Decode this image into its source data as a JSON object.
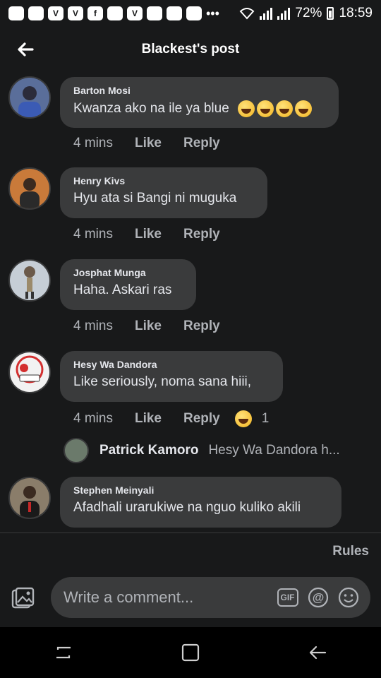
{
  "status_bar": {
    "battery": "72%",
    "time": "18:59",
    "app_icons": [
      "V",
      "V",
      "f",
      "V"
    ]
  },
  "header": {
    "title": "Blackest's post"
  },
  "comments": [
    {
      "name": "Barton Mosi",
      "text": "Kwanza ako na ile ya blue",
      "emojis": [
        "rofl",
        "rofl",
        "rofl",
        "crying"
      ],
      "time": "4 mins",
      "like": "Like",
      "reply": "Reply",
      "avatar_color": "#5a6e9a"
    },
    {
      "name": "Henry Kivs",
      "text": "Hyu ata si Bangi ni muguka",
      "time": "4 mins",
      "like": "Like",
      "reply": "Reply",
      "avatar_color": "#c97a3a"
    },
    {
      "name": "Josphat Munga",
      "text": "Haha. Askari ras",
      "time": "4 mins",
      "like": "Like",
      "reply": "Reply",
      "avatar_color": "#c6ced6"
    },
    {
      "name": "Hesy Wa Dandora",
      "text": "Like seriously, noma sana hiii,",
      "time": "4 mins",
      "like": "Like",
      "reply": "Reply",
      "reaction": "haha",
      "reaction_count": "1",
      "avatar_color": "#f2f2f2"
    },
    {
      "name": "Stephen Meinyali",
      "text": "Afadhali urarukiwe na nguo kuliko akili",
      "avatar_color": "#8a7d6a"
    }
  ],
  "reply_preview": {
    "name": "Patrick Kamoro",
    "text": "Hesy Wa Dandora h..."
  },
  "rules": "Rules",
  "composer": {
    "placeholder": "Write a comment...",
    "gif": "GIF",
    "icons": [
      "photo-icon",
      "gif-icon",
      "mention-icon",
      "emoji-icon"
    ]
  },
  "nav": {
    "icons": [
      "recents-icon",
      "home-icon",
      "back-icon"
    ]
  },
  "colors": {
    "background": "#18191a",
    "bubble": "#3a3b3c",
    "text": "#e4e6eb",
    "muted": "#b0b3b8"
  }
}
